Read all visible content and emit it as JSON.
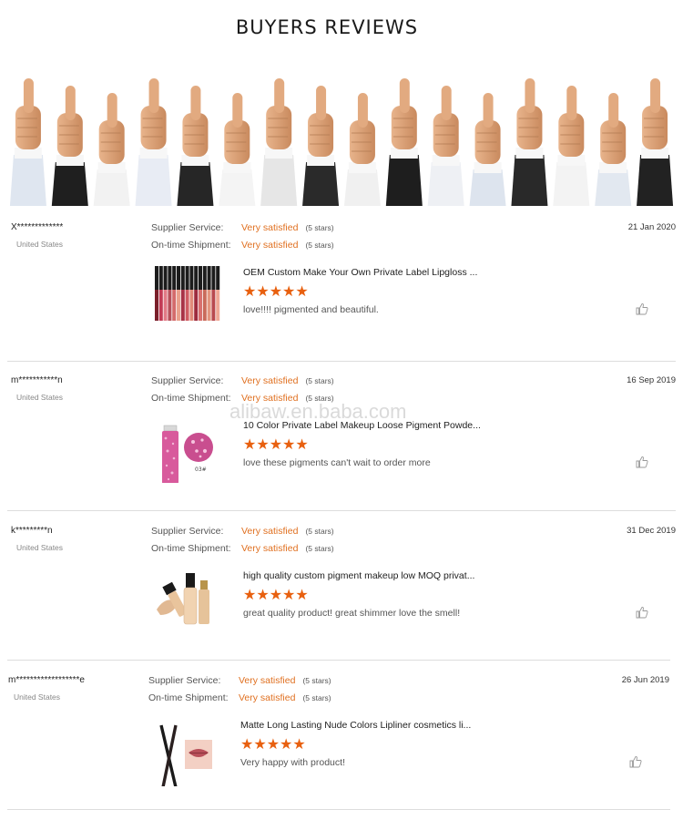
{
  "page": {
    "title": "BUYERS REVIEWS",
    "watermark": "alibaw.en.baba.com"
  },
  "reviews": [
    {
      "user": "X*************",
      "country": "United States",
      "date": "21 Jan 2020",
      "supplier_label": "Supplier Service:",
      "supplier_value": "Very satisfied",
      "supplier_stars": "(5 stars)",
      "shipment_label": "On-time Shipment:",
      "shipment_value": "Very satisfied",
      "shipment_stars": "(5 stars)",
      "product": "OEM Custom Make Your Own Private Label Lipgloss ...",
      "rating": "★★★★★",
      "comment": "love!!!! pigmented and beautiful."
    },
    {
      "user": "m***********n",
      "country": "United States",
      "date": "16 Sep 2019",
      "supplier_label": "Supplier Service:",
      "supplier_value": "Very satisfied",
      "supplier_stars": "(5 stars)",
      "shipment_label": "On-time Shipment:",
      "shipment_value": "Very satisfied",
      "shipment_stars": "(5 stars)",
      "product": "10 Color Private Label Makeup Loose Pigment Powde...",
      "rating": "★★★★★",
      "comment": "love these pigments can't wait to order more",
      "thumb_label": "03#"
    },
    {
      "user": "k*********n",
      "country": "United States",
      "date": "31 Dec 2019",
      "supplier_label": "Supplier Service:",
      "supplier_value": "Very satisfied",
      "supplier_stars": "(5 stars)",
      "shipment_label": "On-time Shipment:",
      "shipment_value": "Very satisfied",
      "shipment_stars": "(5 stars)",
      "product": "high quality custom pigment makeup low MOQ privat...",
      "rating": "★★★★★",
      "comment": "great quality product!  great shimmer love the smell!"
    },
    {
      "user": "m******************e",
      "country": "United States",
      "date": "26 Jun 2019",
      "supplier_label": "Supplier Service:",
      "supplier_value": "Very satisfied",
      "supplier_stars": "(5 stars)",
      "shipment_label": "On-time Shipment:",
      "shipment_value": "Very satisfied",
      "shipment_stars": "(5 stars)",
      "product": "Matte Long Lasting Nude Colors Lipliner cosmetics li...",
      "rating": "★★★★★",
      "comment": "Very happy with product!"
    }
  ],
  "colors": {
    "accent_orange": "#e07020",
    "star_orange": "#e8600f",
    "divider": "#dddddd"
  },
  "icons": {
    "like": "thumbs-up-icon",
    "rating": "star-icon"
  }
}
